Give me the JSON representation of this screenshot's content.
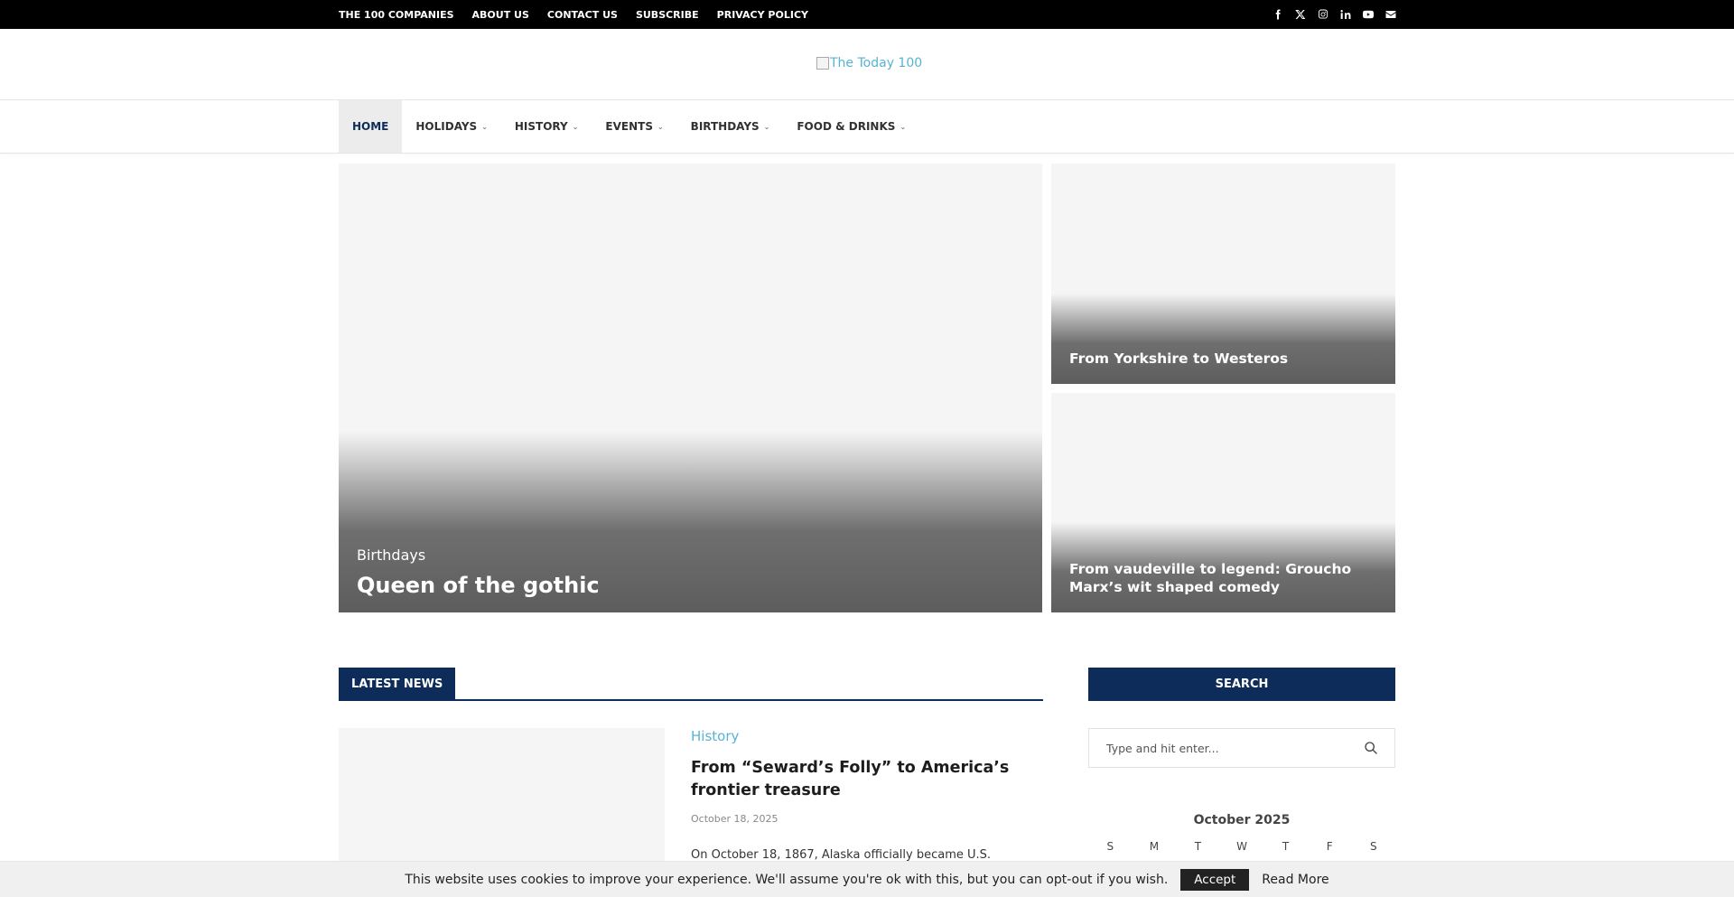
{
  "topbar": {
    "menu": [
      "THE 100 COMPANIES",
      "ABOUT US",
      "CONTACT US",
      "SUBSCRIBE",
      "PRIVACY POLICY"
    ],
    "social": [
      "facebook-icon",
      "x-twitter-icon",
      "instagram-icon",
      "linkedin-icon",
      "youtube-icon",
      "email-icon"
    ]
  },
  "logo": {
    "alt": "The Today 100"
  },
  "nav": {
    "items": [
      {
        "label": "HOME",
        "active": true,
        "has_dropdown": false
      },
      {
        "label": "HOLIDAYS",
        "has_dropdown": true
      },
      {
        "label": "HISTORY",
        "has_dropdown": true
      },
      {
        "label": "EVENTS",
        "has_dropdown": true
      },
      {
        "label": "BIRTHDAYS",
        "has_dropdown": true
      },
      {
        "label": "FOOD & DRINKS",
        "has_dropdown": true
      }
    ]
  },
  "hero": {
    "main": {
      "category": "Birthdays",
      "title": "Queen of the gothic"
    },
    "side": [
      {
        "title": "From Yorkshire to Westeros"
      },
      {
        "title": "From vaudeville to legend: Groucho Marx’s wit shaped comedy"
      }
    ]
  },
  "latest": {
    "heading": "LATEST NEWS",
    "post": {
      "category": "History",
      "title": "From “Seward’s Folly” to America’s frontier treasure",
      "date": "October 18, 2025",
      "excerpt": "On October 18, 1867, Alaska officially became U.S."
    }
  },
  "sidebar": {
    "search_heading": "SEARCH",
    "search_placeholder": "Type and hit enter...",
    "calendar": {
      "month": "October 2025",
      "days": [
        "S",
        "M",
        "T",
        "W",
        "T",
        "F",
        "S"
      ]
    }
  },
  "cookie": {
    "text": "This website uses cookies to improve your experience. We'll assume you're ok with this, but you can opt-out if you wish.",
    "accept": "Accept",
    "read_more": "Read More"
  },
  "colors": {
    "brand_navy": "#0d2c59",
    "link_blue": "#56b4d3",
    "topbar_bg": "#000000"
  }
}
